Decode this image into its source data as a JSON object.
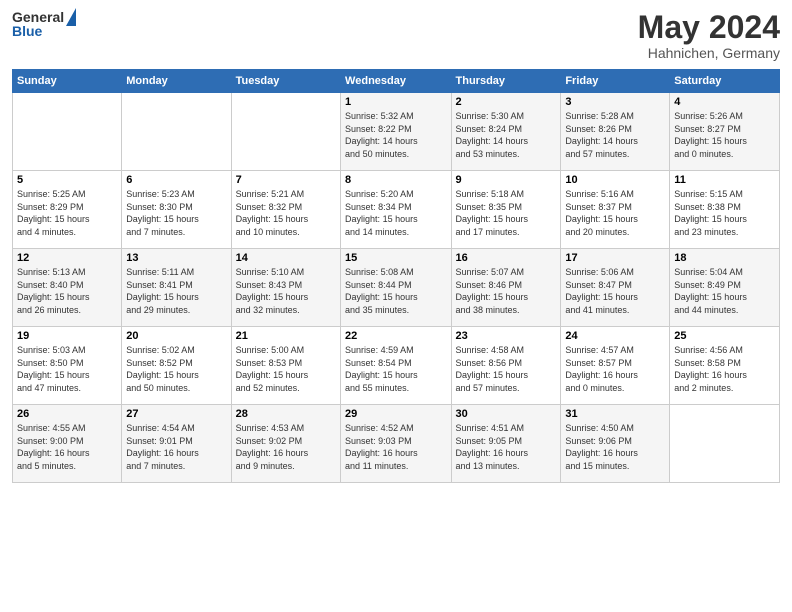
{
  "logo": {
    "general": "General",
    "blue": "Blue"
  },
  "header": {
    "month": "May 2024",
    "location": "Hahnichen, Germany"
  },
  "days_of_week": [
    "Sunday",
    "Monday",
    "Tuesday",
    "Wednesday",
    "Thursday",
    "Friday",
    "Saturday"
  ],
  "weeks": [
    [
      {
        "day": "",
        "content": ""
      },
      {
        "day": "",
        "content": ""
      },
      {
        "day": "",
        "content": ""
      },
      {
        "day": "1",
        "content": "Sunrise: 5:32 AM\nSunset: 8:22 PM\nDaylight: 14 hours\nand 50 minutes."
      },
      {
        "day": "2",
        "content": "Sunrise: 5:30 AM\nSunset: 8:24 PM\nDaylight: 14 hours\nand 53 minutes."
      },
      {
        "day": "3",
        "content": "Sunrise: 5:28 AM\nSunset: 8:26 PM\nDaylight: 14 hours\nand 57 minutes."
      },
      {
        "day": "4",
        "content": "Sunrise: 5:26 AM\nSunset: 8:27 PM\nDaylight: 15 hours\nand 0 minutes."
      }
    ],
    [
      {
        "day": "5",
        "content": "Sunrise: 5:25 AM\nSunset: 8:29 PM\nDaylight: 15 hours\nand 4 minutes."
      },
      {
        "day": "6",
        "content": "Sunrise: 5:23 AM\nSunset: 8:30 PM\nDaylight: 15 hours\nand 7 minutes."
      },
      {
        "day": "7",
        "content": "Sunrise: 5:21 AM\nSunset: 8:32 PM\nDaylight: 15 hours\nand 10 minutes."
      },
      {
        "day": "8",
        "content": "Sunrise: 5:20 AM\nSunset: 8:34 PM\nDaylight: 15 hours\nand 14 minutes."
      },
      {
        "day": "9",
        "content": "Sunrise: 5:18 AM\nSunset: 8:35 PM\nDaylight: 15 hours\nand 17 minutes."
      },
      {
        "day": "10",
        "content": "Sunrise: 5:16 AM\nSunset: 8:37 PM\nDaylight: 15 hours\nand 20 minutes."
      },
      {
        "day": "11",
        "content": "Sunrise: 5:15 AM\nSunset: 8:38 PM\nDaylight: 15 hours\nand 23 minutes."
      }
    ],
    [
      {
        "day": "12",
        "content": "Sunrise: 5:13 AM\nSunset: 8:40 PM\nDaylight: 15 hours\nand 26 minutes."
      },
      {
        "day": "13",
        "content": "Sunrise: 5:11 AM\nSunset: 8:41 PM\nDaylight: 15 hours\nand 29 minutes."
      },
      {
        "day": "14",
        "content": "Sunrise: 5:10 AM\nSunset: 8:43 PM\nDaylight: 15 hours\nand 32 minutes."
      },
      {
        "day": "15",
        "content": "Sunrise: 5:08 AM\nSunset: 8:44 PM\nDaylight: 15 hours\nand 35 minutes."
      },
      {
        "day": "16",
        "content": "Sunrise: 5:07 AM\nSunset: 8:46 PM\nDaylight: 15 hours\nand 38 minutes."
      },
      {
        "day": "17",
        "content": "Sunrise: 5:06 AM\nSunset: 8:47 PM\nDaylight: 15 hours\nand 41 minutes."
      },
      {
        "day": "18",
        "content": "Sunrise: 5:04 AM\nSunset: 8:49 PM\nDaylight: 15 hours\nand 44 minutes."
      }
    ],
    [
      {
        "day": "19",
        "content": "Sunrise: 5:03 AM\nSunset: 8:50 PM\nDaylight: 15 hours\nand 47 minutes."
      },
      {
        "day": "20",
        "content": "Sunrise: 5:02 AM\nSunset: 8:52 PM\nDaylight: 15 hours\nand 50 minutes."
      },
      {
        "day": "21",
        "content": "Sunrise: 5:00 AM\nSunset: 8:53 PM\nDaylight: 15 hours\nand 52 minutes."
      },
      {
        "day": "22",
        "content": "Sunrise: 4:59 AM\nSunset: 8:54 PM\nDaylight: 15 hours\nand 55 minutes."
      },
      {
        "day": "23",
        "content": "Sunrise: 4:58 AM\nSunset: 8:56 PM\nDaylight: 15 hours\nand 57 minutes."
      },
      {
        "day": "24",
        "content": "Sunrise: 4:57 AM\nSunset: 8:57 PM\nDaylight: 16 hours\nand 0 minutes."
      },
      {
        "day": "25",
        "content": "Sunrise: 4:56 AM\nSunset: 8:58 PM\nDaylight: 16 hours\nand 2 minutes."
      }
    ],
    [
      {
        "day": "26",
        "content": "Sunrise: 4:55 AM\nSunset: 9:00 PM\nDaylight: 16 hours\nand 5 minutes."
      },
      {
        "day": "27",
        "content": "Sunrise: 4:54 AM\nSunset: 9:01 PM\nDaylight: 16 hours\nand 7 minutes."
      },
      {
        "day": "28",
        "content": "Sunrise: 4:53 AM\nSunset: 9:02 PM\nDaylight: 16 hours\nand 9 minutes."
      },
      {
        "day": "29",
        "content": "Sunrise: 4:52 AM\nSunset: 9:03 PM\nDaylight: 16 hours\nand 11 minutes."
      },
      {
        "day": "30",
        "content": "Sunrise: 4:51 AM\nSunset: 9:05 PM\nDaylight: 16 hours\nand 13 minutes."
      },
      {
        "day": "31",
        "content": "Sunrise: 4:50 AM\nSunset: 9:06 PM\nDaylight: 16 hours\nand 15 minutes."
      },
      {
        "day": "",
        "content": ""
      }
    ]
  ]
}
